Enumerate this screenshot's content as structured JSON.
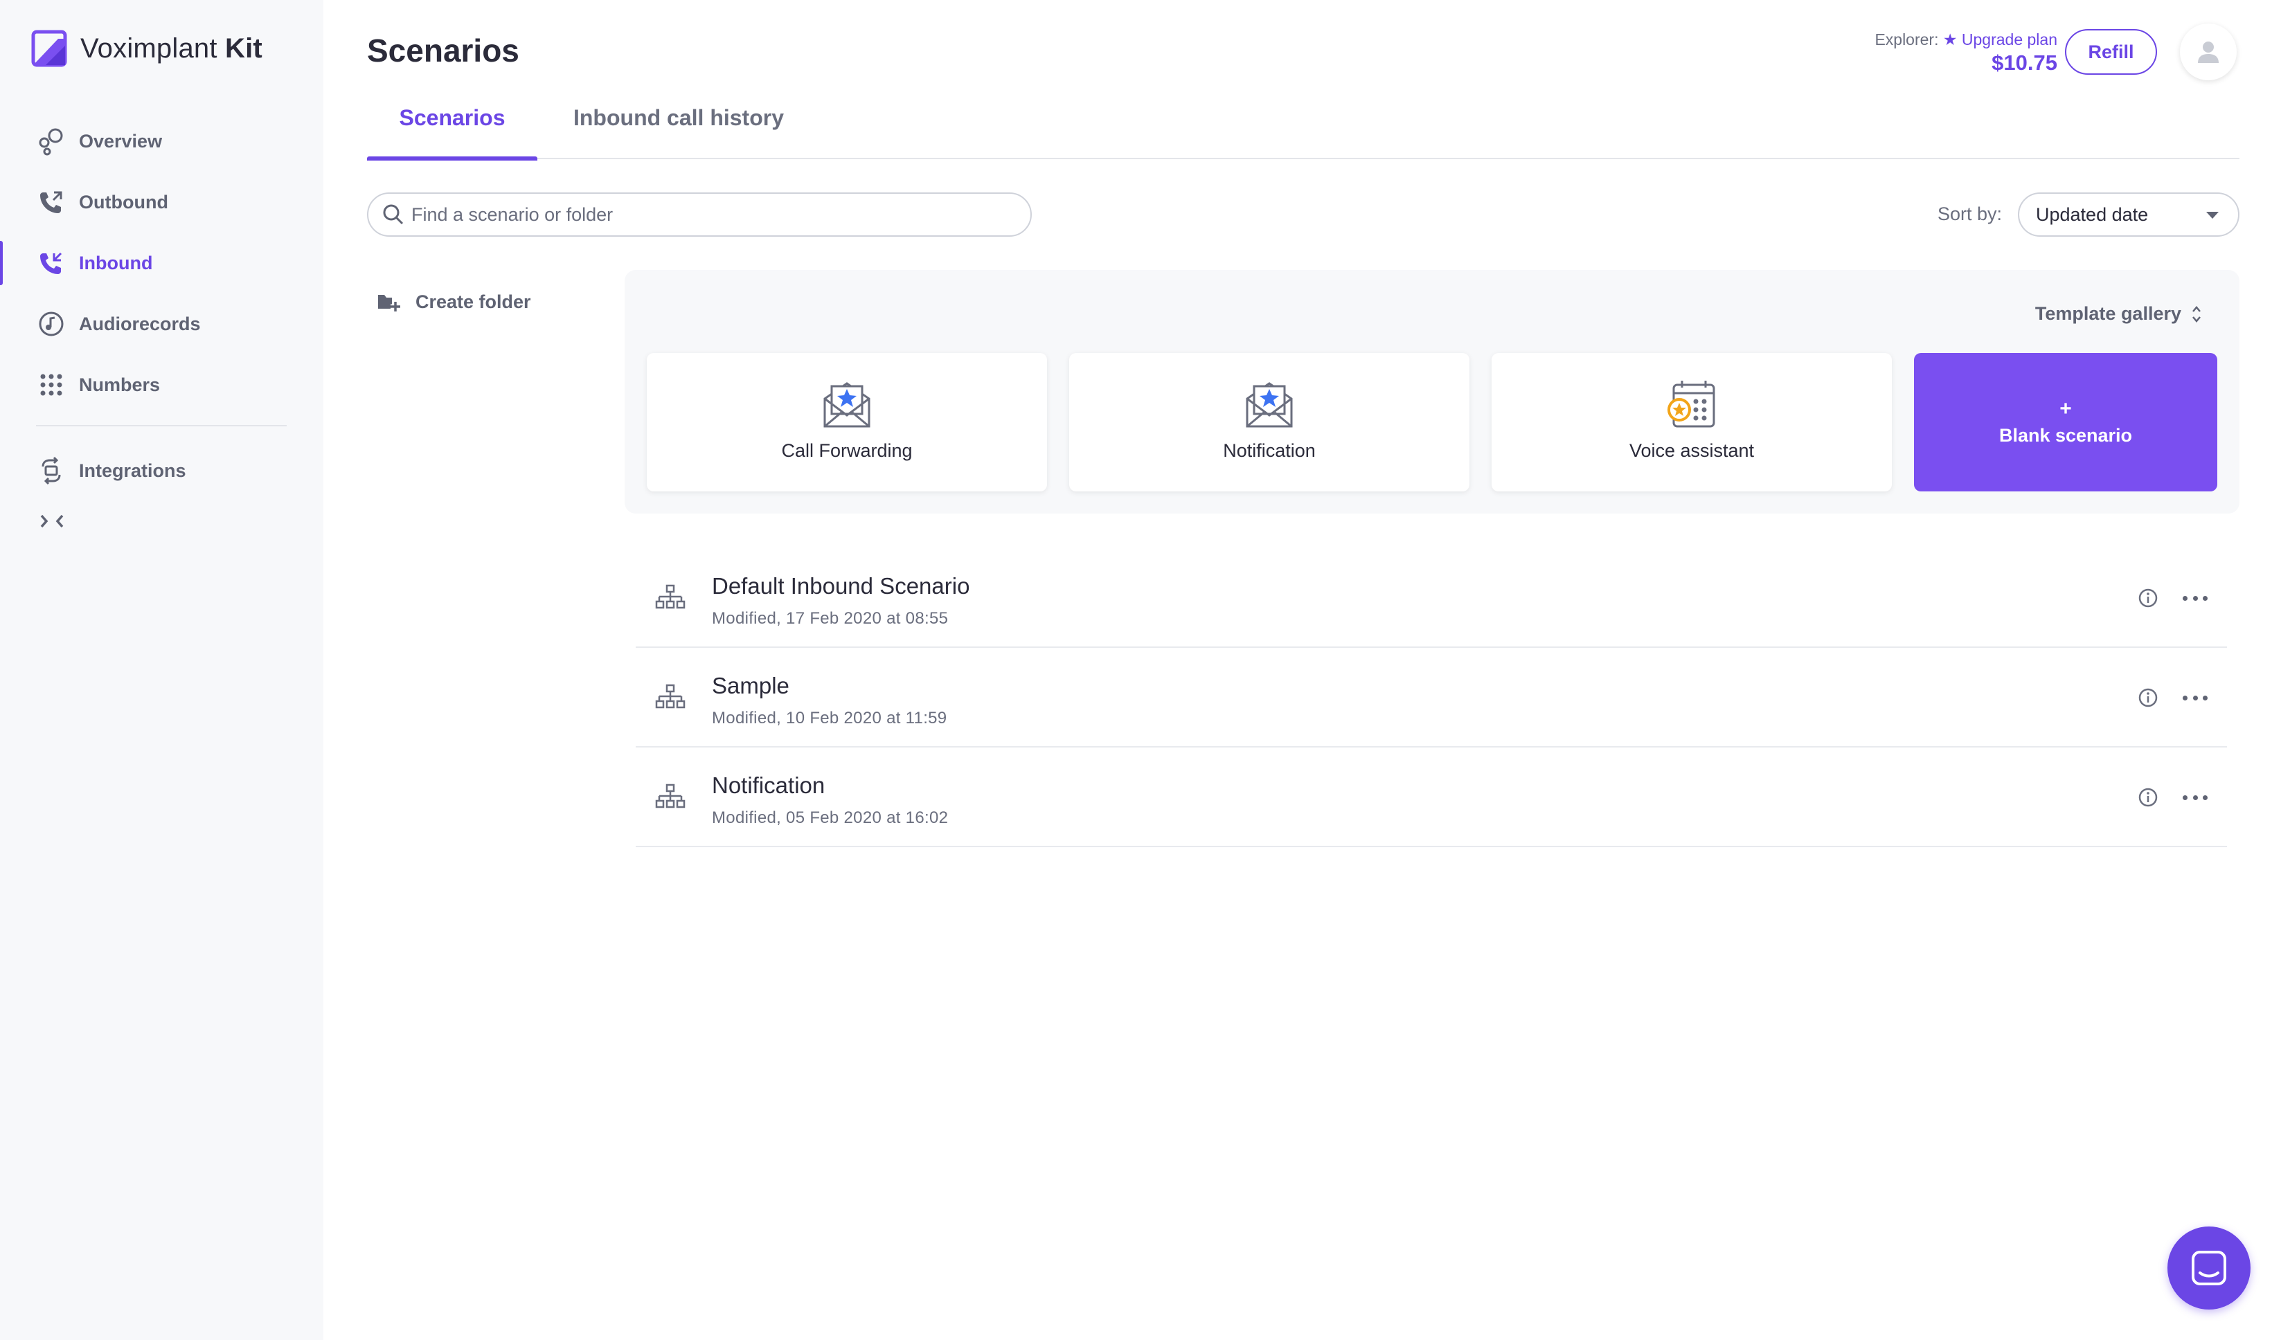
{
  "brand": {
    "name_light": "Voximplant",
    "name_bold": "Kit"
  },
  "sidebar": {
    "items": [
      {
        "label": "Overview",
        "icon": "overview-icon",
        "active": false
      },
      {
        "label": "Outbound",
        "icon": "outbound-call-icon",
        "active": false
      },
      {
        "label": "Inbound",
        "icon": "inbound-call-icon",
        "active": true
      },
      {
        "label": "Audiorecords",
        "icon": "audio-note-icon",
        "active": false
      },
      {
        "label": "Numbers",
        "icon": "dialpad-icon",
        "active": false
      },
      {
        "label": "Integrations",
        "icon": "integrations-icon",
        "active": false
      }
    ],
    "collapse_glyph": "><"
  },
  "header": {
    "title": "Scenarios",
    "tabs": [
      {
        "label": "Scenarios",
        "active": true
      },
      {
        "label": "Inbound call history",
        "active": false
      }
    ],
    "account": {
      "plan_label": "Explorer:",
      "upgrade_label": "Upgrade plan",
      "balance": "$10.75",
      "refill_label": "Refill"
    }
  },
  "search": {
    "placeholder": "Find a scenario or folder",
    "value": ""
  },
  "sort": {
    "label": "Sort by:",
    "value": "Updated date"
  },
  "create_folder_label": "Create folder",
  "templates": {
    "gallery_label": "Template gallery",
    "cards": [
      {
        "label": "Call Forwarding",
        "icon": "envelope-star-icon"
      },
      {
        "label": "Notification",
        "icon": "envelope-star-icon"
      },
      {
        "label": "Voice assistant",
        "icon": "calendar-star-icon"
      }
    ],
    "blank": {
      "plus": "+",
      "label": "Blank scenario"
    }
  },
  "scenarios": [
    {
      "name": "Default Inbound Scenario",
      "modified": "Modified, 17 Feb 2020 at 08:55"
    },
    {
      "name": "Sample",
      "modified": "Modified, 10 Feb 2020 at 11:59"
    },
    {
      "name": "Notification",
      "modified": "Modified, 05 Feb 2020 at 16:02"
    }
  ],
  "colors": {
    "accent": "#6b46e5",
    "blank_card": "#7a4ff0",
    "sidebar_bg": "#f7f8fa",
    "panel_bg": "#f7f8fa"
  }
}
